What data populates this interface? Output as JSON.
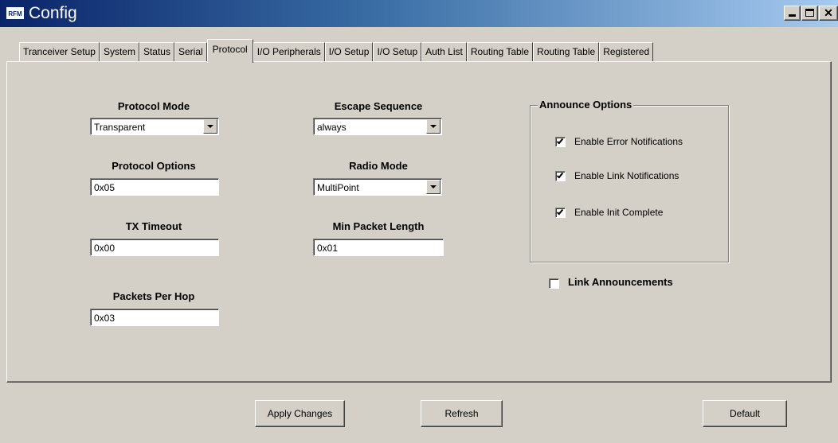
{
  "window": {
    "icon_text": "RFM",
    "title": "Config"
  },
  "tabs": [
    {
      "label": "Tranceiver Setup",
      "active": false
    },
    {
      "label": "System",
      "active": false
    },
    {
      "label": "Status",
      "active": false
    },
    {
      "label": "Serial",
      "active": false
    },
    {
      "label": "Protocol",
      "active": true
    },
    {
      "label": "I/O Peripherals",
      "active": false
    },
    {
      "label": "I/O Setup",
      "active": false
    },
    {
      "label": "I/O Setup",
      "active": false
    },
    {
      "label": "Auth List",
      "active": false
    },
    {
      "label": "Routing Table",
      "active": false
    },
    {
      "label": "Routing Table",
      "active": false
    },
    {
      "label": "Registered",
      "active": false
    }
  ],
  "protocol": {
    "protocol_mode": {
      "label": "Protocol Mode",
      "value": "Transparent"
    },
    "protocol_options": {
      "label": "Protocol Options",
      "value": "0x05"
    },
    "tx_timeout": {
      "label": "TX Timeout",
      "value": "0x00"
    },
    "packets_per_hop": {
      "label": "Packets Per Hop",
      "value": "0x03"
    },
    "escape_sequence": {
      "label": "Escape Sequence",
      "value": "always"
    },
    "radio_mode": {
      "label": "Radio Mode",
      "value": "MultiPoint"
    },
    "min_packet_length": {
      "label": "Min Packet Length",
      "value": "0x01"
    }
  },
  "announce_options": {
    "title": "Announce Options",
    "items": [
      {
        "label": "Enable Error Notifications",
        "checked": true
      },
      {
        "label": "Enable Link Notifications",
        "checked": true
      },
      {
        "label": "Enable Init Complete",
        "checked": true
      }
    ]
  },
  "link_announcements": {
    "label": "Link Announcements",
    "checked": false
  },
  "buttons": {
    "apply": "Apply Changes",
    "refresh": "Refresh",
    "default": "Default"
  }
}
